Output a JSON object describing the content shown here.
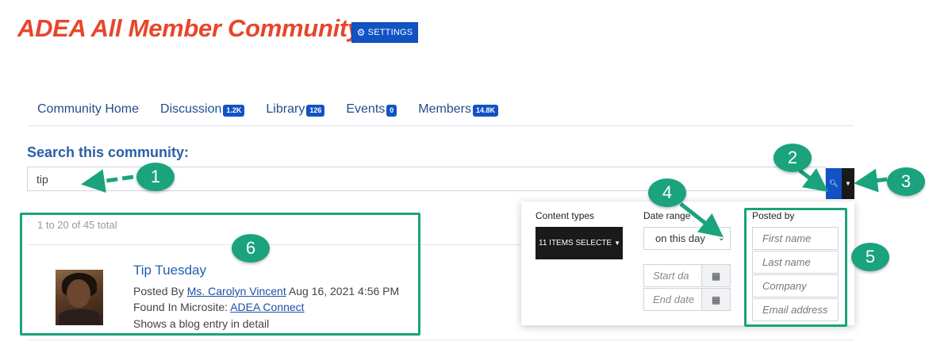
{
  "header": {
    "title": "ADEA All Member Community",
    "settings_label": "SETTINGS"
  },
  "nav": {
    "home": "Community Home",
    "discussion": {
      "label": "Discussion",
      "count": "1.2K"
    },
    "library": {
      "label": "Library",
      "count": "126"
    },
    "events": {
      "label": "Events",
      "count": "0"
    },
    "members": {
      "label": "Members",
      "count": "14.8K"
    }
  },
  "search": {
    "label": "Search this community:",
    "value": "tip"
  },
  "results": {
    "count_text": "1 to 20 of 45 total",
    "item": {
      "title": "Tip Tuesday",
      "posted_by_prefix": "Posted By",
      "author": "Ms. Carolyn Vincent",
      "date": "Aug 16, 2021 4:56 PM",
      "found_in_prefix": "Found In Microsite:",
      "microsite": "ADEA Connect",
      "description": "Shows a blog entry in detail"
    }
  },
  "filters": {
    "content_types_label": "Content types",
    "content_types_value": "11 ITEMS SELECTE",
    "date_range_label": "Date range",
    "date_range_value": "on this day",
    "start_date_placeholder": "Start da",
    "end_date_placeholder": "End date",
    "posted_by_label": "Posted by",
    "first_name_placeholder": "First name",
    "last_name_placeholder": "Last name",
    "company_placeholder": "Company",
    "email_placeholder": "Email address"
  },
  "callouts": [
    "1",
    "2",
    "3",
    "4",
    "5",
    "6"
  ],
  "colors": {
    "accent_title": "#e8452c",
    "primary_blue": "#1153c4",
    "callout_green": "#1aa37d"
  }
}
